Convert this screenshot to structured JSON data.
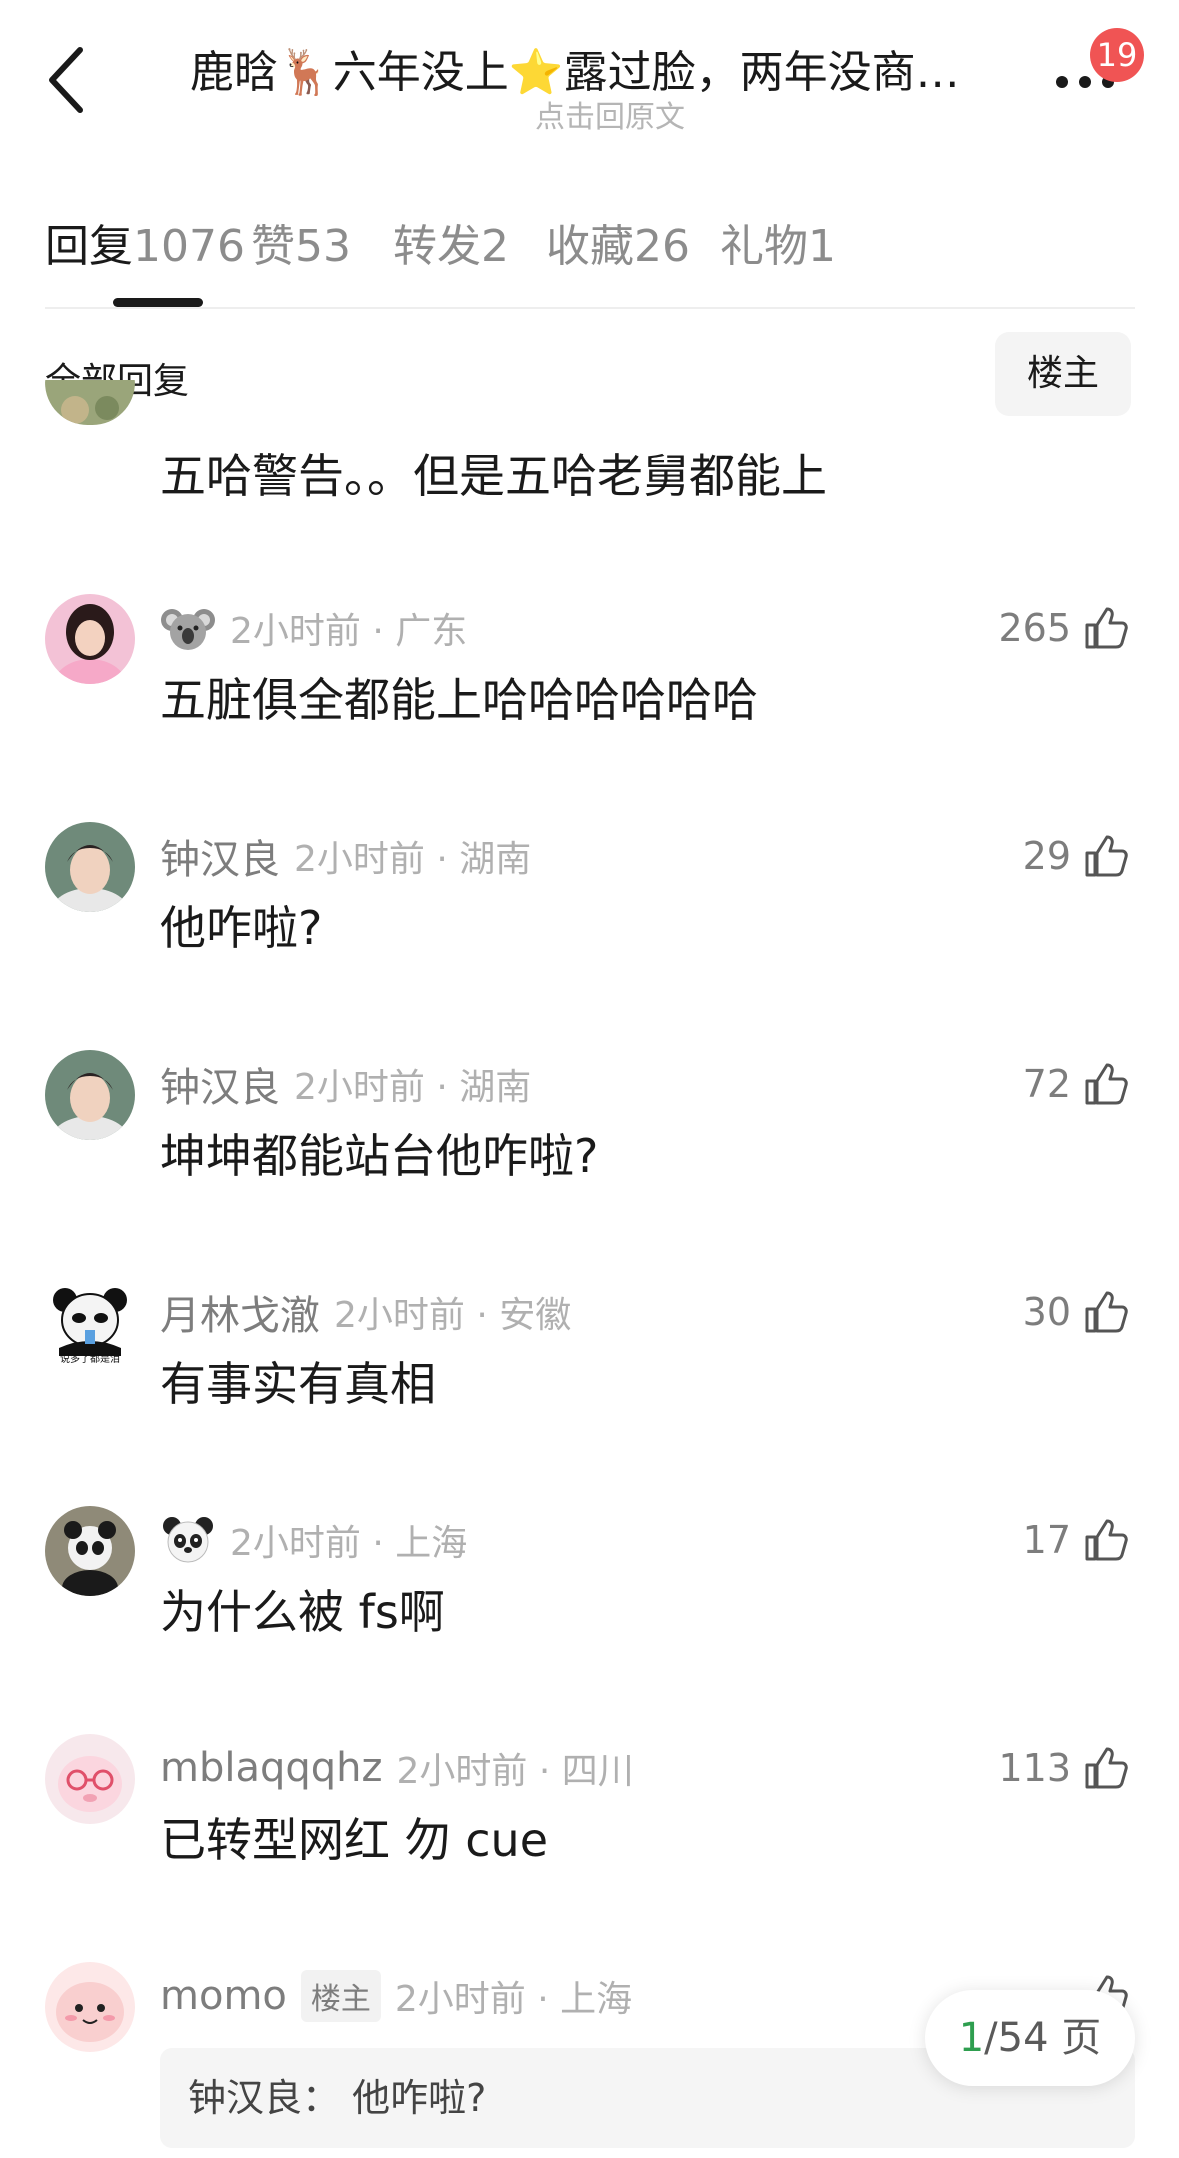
{
  "header": {
    "title": "鹿晗🦌六年没上⭐露过脸，两年没商…",
    "subtitle": "点击回原文",
    "notif_count": "19"
  },
  "tabs": [
    {
      "label": "回复",
      "count": "1076",
      "active": true
    },
    {
      "label": "赞",
      "count": "53"
    },
    {
      "label": "转发",
      "count": "2"
    },
    {
      "label": "收藏",
      "count": "26"
    },
    {
      "label": "礼物",
      "count": "1"
    }
  ],
  "section": {
    "title": "全部回复",
    "owner_filter": "楼主"
  },
  "partial_comment": {
    "content": "五哈警告。。但是五哈老舅都能上"
  },
  "comments": [
    {
      "name": "",
      "name_emoji": "koala-emoji",
      "time": "2小时前 · 广东",
      "likes": "265",
      "content": "五脏俱全都能上哈哈哈哈哈哈",
      "avatar": "girl-avatar"
    },
    {
      "name": "钟汉良",
      "time": "2小时前 · 湖南",
      "likes": "29",
      "content": "他咋啦?",
      "avatar": "man-avatar"
    },
    {
      "name": "钟汉良",
      "time": "2小时前 · 湖南",
      "likes": "72",
      "content": "坤坤都能站台他咋啦?",
      "avatar": "man-avatar"
    },
    {
      "name": "月林戈澈",
      "time": "2小时前 · 安徽",
      "likes": "30",
      "content": "有事实有真相",
      "avatar": "panda-meme-avatar",
      "avatar_caption": "说多了都是泪"
    },
    {
      "name": "",
      "name_emoji": "panda-emoji",
      "time": "2小时前 · 上海",
      "likes": "17",
      "content": "为什么被 fs啊",
      "avatar": "panda-avatar"
    },
    {
      "name": "mblaqqqhz",
      "time": "2小时前 · 四川",
      "likes": "113",
      "content": "已转型网红 勿 cue",
      "avatar": "pig-avatar"
    },
    {
      "name": "momo",
      "tag": "楼主",
      "time": "2小时前 · 上海",
      "likes": "",
      "avatar": "pink-blob-avatar",
      "quote": "钟汉良：  他咋啦?"
    }
  ],
  "pager": {
    "current": "1",
    "total": "/54 页"
  },
  "colors": {
    "badge": "#f05454",
    "pager_current": "#2e9e4f",
    "meta_gray": "#7d7d7d"
  }
}
